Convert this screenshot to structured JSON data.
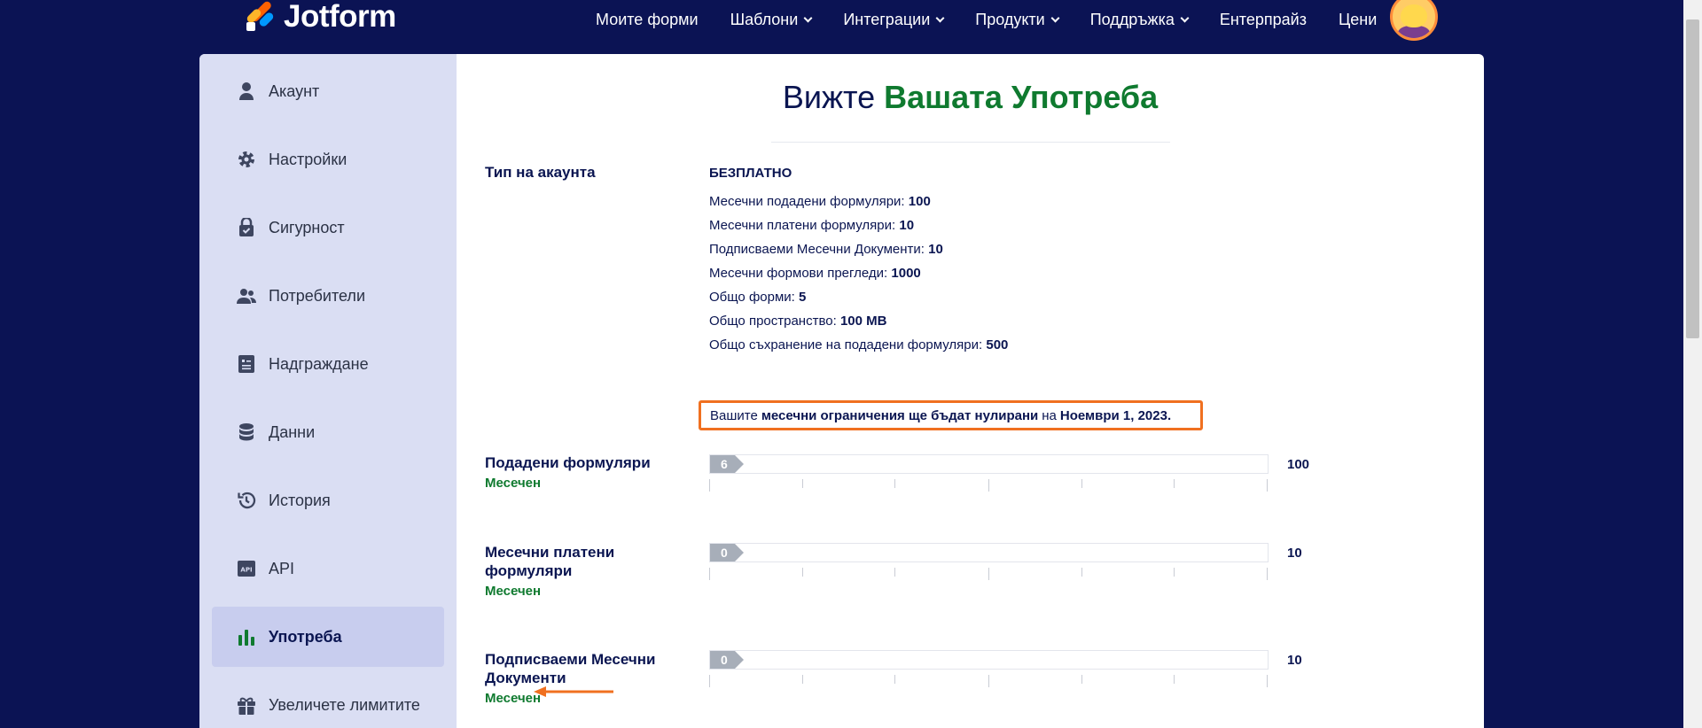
{
  "brand": {
    "name": "Jotform"
  },
  "nav": {
    "items": [
      {
        "label": "Моите форми",
        "dropdown": false
      },
      {
        "label": "Шаблони",
        "dropdown": true
      },
      {
        "label": "Интеграции",
        "dropdown": true
      },
      {
        "label": "Продукти",
        "dropdown": true
      },
      {
        "label": "Поддръжка",
        "dropdown": true
      },
      {
        "label": "Ентерпрайз",
        "dropdown": false
      },
      {
        "label": "Цени",
        "dropdown": false
      }
    ]
  },
  "sidebar": {
    "items": [
      {
        "label": "Акаунт",
        "icon": "user-icon"
      },
      {
        "label": "Настройки",
        "icon": "gear-icon"
      },
      {
        "label": "Сигурност",
        "icon": "shield-icon"
      },
      {
        "label": "Потребители",
        "icon": "users-icon"
      },
      {
        "label": "Надграждане",
        "icon": "upgrade-icon"
      },
      {
        "label": "Данни",
        "icon": "database-icon"
      },
      {
        "label": "История",
        "icon": "history-icon"
      },
      {
        "label": "API",
        "icon": "api-icon"
      },
      {
        "label": "Употреба",
        "icon": "bar-chart-icon",
        "active": true
      },
      {
        "label": "Увеличете лимитите",
        "icon": "gift-icon"
      }
    ]
  },
  "page": {
    "title_part1": "Вижте",
    "title_part2": "Вашата Употреба"
  },
  "account": {
    "label": "Тип на акаунта",
    "plan": "БЕЗПЛАТНО",
    "limits": [
      {
        "label": "Месечни подадени формуляри:",
        "value": "100"
      },
      {
        "label": "Месечни платени формуляри:",
        "value": "10"
      },
      {
        "label": "Подписваеми Месечни Документи:",
        "value": "10"
      },
      {
        "label": "Месечни формови прегледи:",
        "value": "1000"
      },
      {
        "label": "Общо форми:",
        "value": "5"
      },
      {
        "label": "Общо пространство:",
        "value": "100 MB"
      },
      {
        "label": "Общо съхранение на подадени формуляри:",
        "value": "500"
      }
    ]
  },
  "notice": {
    "prefix": "Вашите",
    "bold1": "месечни ограничения ще бъдат нулирани",
    "middle": "на",
    "bold2": "Ноември 1, 2023."
  },
  "usage": [
    {
      "label": "Подадени формуляри",
      "period": "Месечен",
      "used": "6",
      "limit": "100",
      "fraction": 0.06
    },
    {
      "label": "Месечни платени формуляри",
      "period": "Месечен",
      "used": "0",
      "limit": "10",
      "fraction": 0.0
    },
    {
      "label": "Подписваеми Месечни Документи",
      "period": "Месечен",
      "used": "0",
      "limit": "10",
      "fraction": 0.0
    }
  ],
  "colors": {
    "navy": "#0b1354",
    "green": "#0f7a2f",
    "accent_orange": "#f07020",
    "sidebar_bg": "#dadef3"
  }
}
